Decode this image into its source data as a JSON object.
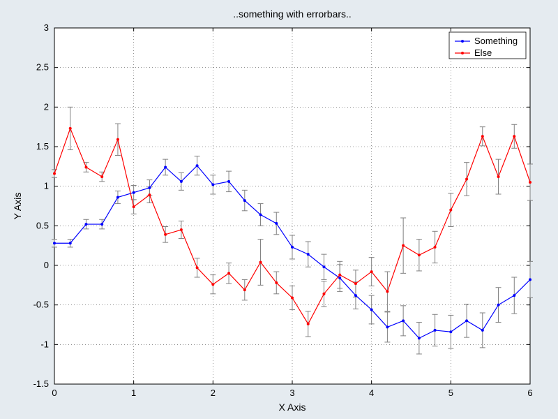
{
  "chart_data": {
    "type": "line",
    "title": "..something with errorbars..",
    "xlabel": "X Axis",
    "ylabel": "Y Axis",
    "xlim": [
      0,
      6
    ],
    "ylim": [
      -1.5,
      3
    ],
    "xticks": [
      0,
      1,
      2,
      3,
      4,
      5,
      6
    ],
    "yticks": [
      -1.5,
      -1.0,
      -0.5,
      0,
      0.5,
      1.0,
      1.5,
      2.0,
      2.5,
      3.0
    ],
    "legend_position": "top-right",
    "marker": "dot",
    "errorbars": true,
    "series": [
      {
        "name": "Something",
        "color": "#0000ff",
        "x": [
          0.0,
          0.2,
          0.4,
          0.6,
          0.8,
          1.0,
          1.2,
          1.4,
          1.6,
          1.8,
          2.0,
          2.2,
          2.4,
          2.6,
          2.8,
          3.0,
          3.2,
          3.4,
          3.6,
          3.8,
          4.0,
          4.2,
          4.4,
          4.6,
          4.8,
          5.0,
          5.2,
          5.4,
          5.6,
          5.8,
          6.0
        ],
        "y": [
          0.28,
          0.28,
          0.52,
          0.52,
          0.86,
          0.92,
          0.98,
          1.24,
          1.06,
          1.26,
          1.02,
          1.06,
          0.82,
          0.64,
          0.53,
          0.23,
          0.14,
          -0.02,
          -0.16,
          -0.38,
          -0.56,
          -0.78,
          -0.7,
          -0.92,
          -0.82,
          -0.84,
          -0.7,
          -0.82,
          -0.5,
          -0.38,
          -0.18
        ],
        "err": [
          0.05,
          0.05,
          0.06,
          0.06,
          0.08,
          0.09,
          0.1,
          0.1,
          0.11,
          0.12,
          0.12,
          0.13,
          0.13,
          0.14,
          0.14,
          0.15,
          0.16,
          0.16,
          0.17,
          0.17,
          0.18,
          0.19,
          0.19,
          0.2,
          0.2,
          0.21,
          0.21,
          0.22,
          0.22,
          0.23,
          0.23
        ]
      },
      {
        "name": "Else",
        "color": "#ff0000",
        "x": [
          0.0,
          0.2,
          0.4,
          0.6,
          0.8,
          1.0,
          1.2,
          1.4,
          1.6,
          1.8,
          2.0,
          2.2,
          2.4,
          2.6,
          2.8,
          3.0,
          3.2,
          3.4,
          3.6,
          3.8,
          4.0,
          4.2,
          4.4,
          4.6,
          4.8,
          5.0,
          5.2,
          5.4,
          5.6,
          5.8,
          6.0
        ],
        "y": [
          1.16,
          1.73,
          1.24,
          1.12,
          1.59,
          0.74,
          0.89,
          0.39,
          0.45,
          -0.03,
          -0.24,
          -0.1,
          -0.31,
          0.04,
          -0.22,
          -0.41,
          -0.74,
          -0.36,
          -0.12,
          -0.23,
          -0.08,
          -0.33,
          0.25,
          0.13,
          0.23,
          0.7,
          1.09,
          1.63,
          1.12,
          1.63,
          1.05
        ],
        "err": [
          0.05,
          0.27,
          0.06,
          0.06,
          0.2,
          0.09,
          0.1,
          0.1,
          0.11,
          0.12,
          0.12,
          0.13,
          0.13,
          0.29,
          0.14,
          0.15,
          0.16,
          0.16,
          0.17,
          0.17,
          0.18,
          0.25,
          0.35,
          0.2,
          0.2,
          0.21,
          0.21,
          0.12,
          0.22,
          0.15,
          0.23
        ]
      }
    ]
  }
}
